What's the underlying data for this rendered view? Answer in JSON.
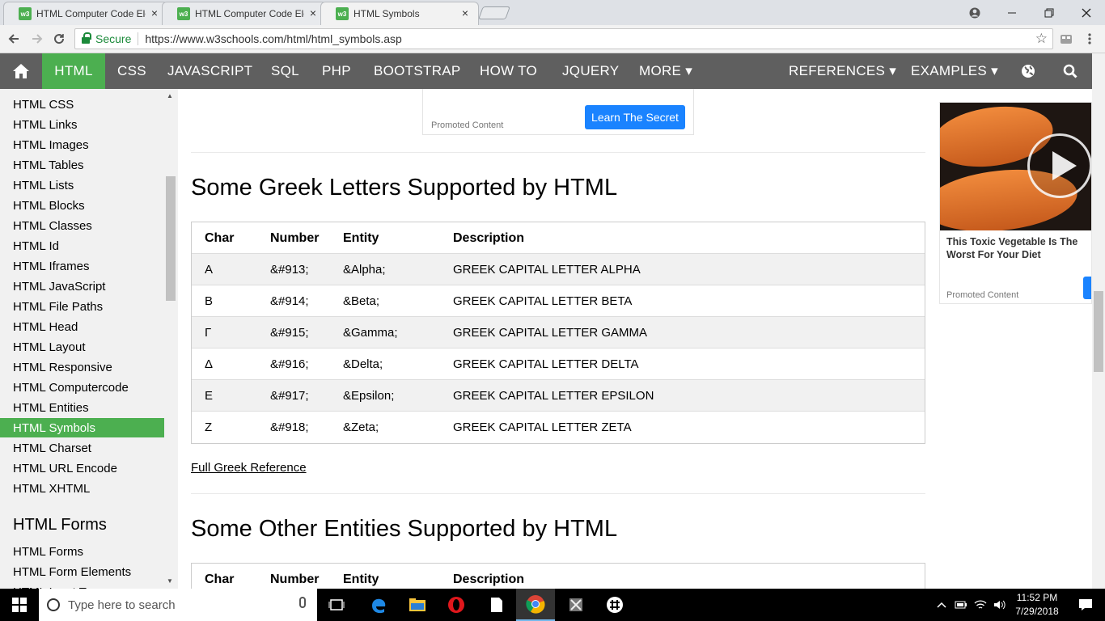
{
  "browser": {
    "tabs": [
      {
        "title": "HTML Computer Code Ele",
        "favicon": "w3"
      },
      {
        "title": "HTML Computer Code Ele",
        "favicon": "w3"
      },
      {
        "title": "HTML Symbols",
        "favicon": "w3"
      }
    ],
    "close_glyph": "×",
    "secure_label": "Secure",
    "url": "https://www.w3schools.com/html/html_symbols.asp"
  },
  "topnav": {
    "items": [
      "HTML",
      "CSS",
      "JAVASCRIPT",
      "SQL",
      "PHP",
      "BOOTSTRAP",
      "HOW TO",
      "JQUERY",
      "MORE ▾"
    ],
    "right_items": [
      "REFERENCES ▾",
      "EXAMPLES ▾"
    ],
    "active": "HTML",
    "accent_color": "#4caf50",
    "bg_color": "#5f5f5f"
  },
  "sidebar": {
    "items": [
      "HTML CSS",
      "HTML Links",
      "HTML Images",
      "HTML Tables",
      "HTML Lists",
      "HTML Blocks",
      "HTML Classes",
      "HTML Id",
      "HTML Iframes",
      "HTML JavaScript",
      "HTML File Paths",
      "HTML Head",
      "HTML Layout",
      "HTML Responsive",
      "HTML Computercode",
      "HTML Entities",
      "HTML Symbols",
      "HTML Charset",
      "HTML URL Encode",
      "HTML XHTML"
    ],
    "active_item": "HTML Symbols",
    "section_heading": "HTML Forms",
    "section_items": [
      "HTML Forms",
      "HTML Form Elements",
      "HTML Input Types"
    ]
  },
  "ad_top": {
    "promo_label": "Promoted Content",
    "button_label": "Learn The Secret"
  },
  "greek_section": {
    "heading": "Some Greek Letters Supported by HTML",
    "columns": [
      "Char",
      "Number",
      "Entity",
      "Description"
    ],
    "rows": [
      [
        "Α",
        "&#913;",
        "&Alpha;",
        "GREEK CAPITAL LETTER ALPHA"
      ],
      [
        "Β",
        "&#914;",
        "&Beta;",
        "GREEK CAPITAL LETTER BETA"
      ],
      [
        "Γ",
        "&#915;",
        "&Gamma;",
        "GREEK CAPITAL LETTER GAMMA"
      ],
      [
        "Δ",
        "&#916;",
        "&Delta;",
        "GREEK CAPITAL LETTER DELTA"
      ],
      [
        "Ε",
        "&#917;",
        "&Epsilon;",
        "GREEK CAPITAL LETTER EPSILON"
      ],
      [
        "Ζ",
        "&#918;",
        "&Zeta;",
        "GREEK CAPITAL LETTER ZETA"
      ]
    ],
    "reference_link": "Full Greek Reference"
  },
  "other_section": {
    "heading": "Some Other Entities Supported by HTML",
    "columns": [
      "Char",
      "Number",
      "Entity",
      "Description"
    ]
  },
  "ad_right": {
    "headline": "This Toxic Vegetable Is The Worst For Your Diet",
    "promo_label": "Promoted Content"
  },
  "taskbar": {
    "search_placeholder": "Type here to search",
    "time": "11:52 PM",
    "date": "7/29/2018"
  }
}
